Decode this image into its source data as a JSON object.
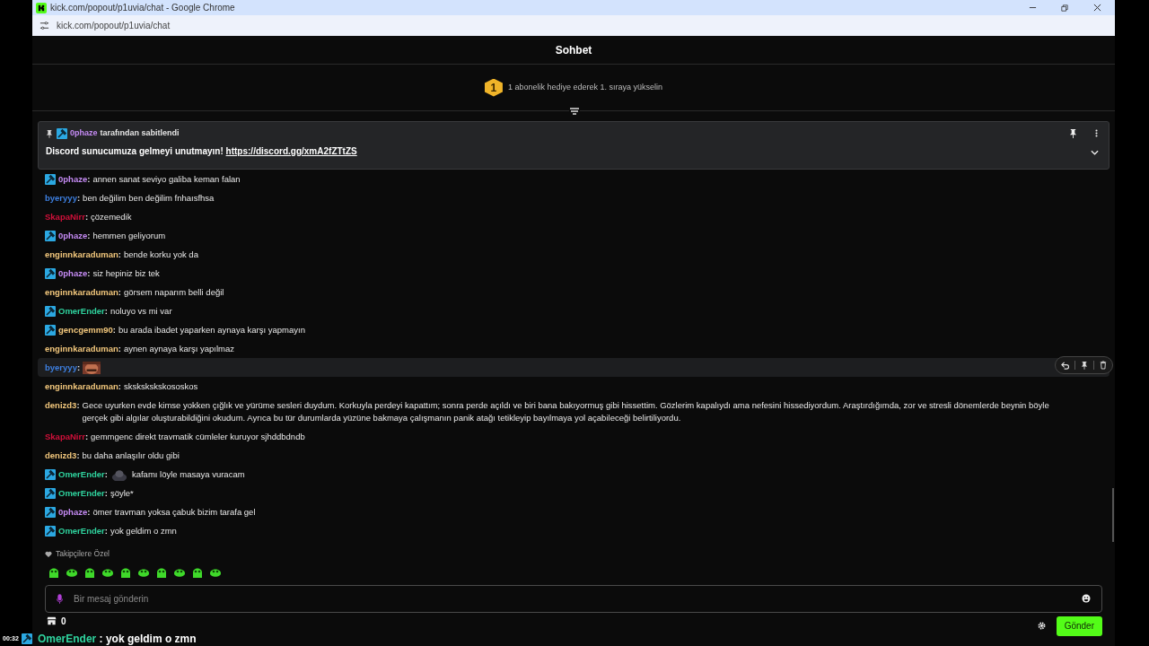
{
  "browser": {
    "title": "kick.com/popout/p1uvia/chat - Google Chrome",
    "url": "kick.com/popout/p1uvia/chat"
  },
  "chat": {
    "title": "Sohbet",
    "goal": {
      "badge": "1",
      "text": "1 abonelik hediye ederek 1. sıraya yükselin"
    },
    "pinned": {
      "user": "0phaze",
      "color": "#c58bf4",
      "mod": true,
      "by_text": "tarafından sabitlendi",
      "message": "Discord sunucumuza gelmeyi unutmayın!",
      "link": "https://discord.gg/xmA2fZTtZS"
    },
    "messages": [
      {
        "user": "0phaze",
        "sep": ":",
        "color": "#c58bf4",
        "mod": true,
        "emote": false,
        "highlighted": false,
        "text": "annen sanat seviyo galiba keman falan"
      },
      {
        "user": "byeryyy",
        "sep": ":",
        "color": "#3d7fe0",
        "mod": false,
        "emote": false,
        "highlighted": false,
        "text": "ben değilim ben değilim fnhaısfhsa"
      },
      {
        "user": "SkapaNirr",
        "sep": ":",
        "color": "#d0103a",
        "mod": false,
        "emote": false,
        "highlighted": false,
        "text": "çözemedik"
      },
      {
        "user": "0phaze",
        "sep": ":",
        "color": "#c58bf4",
        "mod": true,
        "emote": false,
        "highlighted": false,
        "text": "hemmen geliyorum"
      },
      {
        "user": "enginnkaraduman",
        "sep": ":",
        "color": "#f2c77c",
        "mod": false,
        "emote": false,
        "highlighted": false,
        "text": "bende korku yok da"
      },
      {
        "user": "0phaze",
        "sep": ":",
        "color": "#c58bf4",
        "mod": true,
        "emote": false,
        "highlighted": false,
        "text": "siz hepiniz biz tek"
      },
      {
        "user": "enginnkaraduman",
        "sep": ":",
        "color": "#f2c77c",
        "mod": false,
        "emote": false,
        "highlighted": false,
        "text": "görsem naparım belli değil"
      },
      {
        "user": "OmerEnder",
        "sep": ":",
        "color": "#2fd39e",
        "mod": true,
        "emote": false,
        "highlighted": false,
        "text": "noluyo vs mi var"
      },
      {
        "user": "gencgemm90",
        "sep": ":",
        "color": "#f2c77c",
        "mod": true,
        "emote": false,
        "highlighted": false,
        "text": "bu arada ibadet yaparken aynaya karşı yapmayın"
      },
      {
        "user": "enginnkaraduman",
        "sep": ":",
        "color": "#f2c77c",
        "mod": false,
        "emote": false,
        "highlighted": false,
        "text": "aynen aynaya karşı yapılmaz"
      },
      {
        "user": "byeryyy",
        "sep": ":",
        "color": "#3d7fe0",
        "mod": false,
        "emote": true,
        "highlighted": true
      },
      {
        "user": "enginnkaraduman",
        "sep": ":",
        "color": "#f2c77c",
        "mod": false,
        "emote": false,
        "highlighted": false,
        "text": "skskskskskososkos"
      },
      {
        "user": "denizd3",
        "sep": ":",
        "color": "#f2c77c",
        "mod": false,
        "emote": false,
        "highlighted": false,
        "text": "Gece uyurken evde kimse yokken çığlık ve yürüme sesleri duydum. Korkuyla perdeyi kapattım; sonra perde açıldı ve biri bana bakıyormuş gibi hissettim. Gözlerim kapalıydı ama nefesini hissediyordum. Araştırdığımda, zor ve stresli dönemlerde beynin böyle gerçek gibi algılar oluşturabildiğini okudum. Ayrıca bu tür durumlarda yüzüne bakmaya çalışmanın panik atağı tetikleyip bayılmaya yol açabileceği belirtiliyordu."
      },
      {
        "user": "SkapaNirr",
        "sep": ":",
        "color": "#d0103a",
        "mod": false,
        "emote": false,
        "highlighted": false,
        "text": "gemmgenc direkt travmatik cümleler kuruyor sjhddbdndb"
      },
      {
        "user": "denizd3",
        "sep": ":",
        "color": "#f2c77c",
        "mod": false,
        "emote": false,
        "highlighted": false,
        "text": "bu daha anlaşılır oldu gibi"
      },
      {
        "user": "OmerEnder",
        "sep": ":",
        "color": "#2fd39e",
        "mod": true,
        "emote": true,
        "highlighted": false,
        "text": "kafamı löyle masaya vuracam"
      },
      {
        "user": "OmerEnder",
        "sep": ":",
        "color": "#2fd39e",
        "mod": true,
        "emote": false,
        "highlighted": false,
        "text": "şöyle*"
      },
      {
        "user": "0phaze",
        "sep": ":",
        "color": "#c58bf4",
        "mod": true,
        "emote": false,
        "highlighted": false,
        "text": "ömer travman yoksa çabuk bizim tarafa gel"
      },
      {
        "user": "OmerEnder",
        "sep": ":",
        "color": "#2fd39e",
        "mod": true,
        "emote": false,
        "highlighted": false,
        "text": "yok geldim o zmn"
      }
    ],
    "emote_section": "Takipçilere Özel",
    "input": {
      "placeholder": "Bir mesaj gönderin"
    },
    "points": "0",
    "send": "Gönder"
  },
  "overlay": {
    "time": "00:32",
    "user": "OmerEnder",
    "color": "#2fd39e",
    "text": ": yok geldim o zmn"
  }
}
